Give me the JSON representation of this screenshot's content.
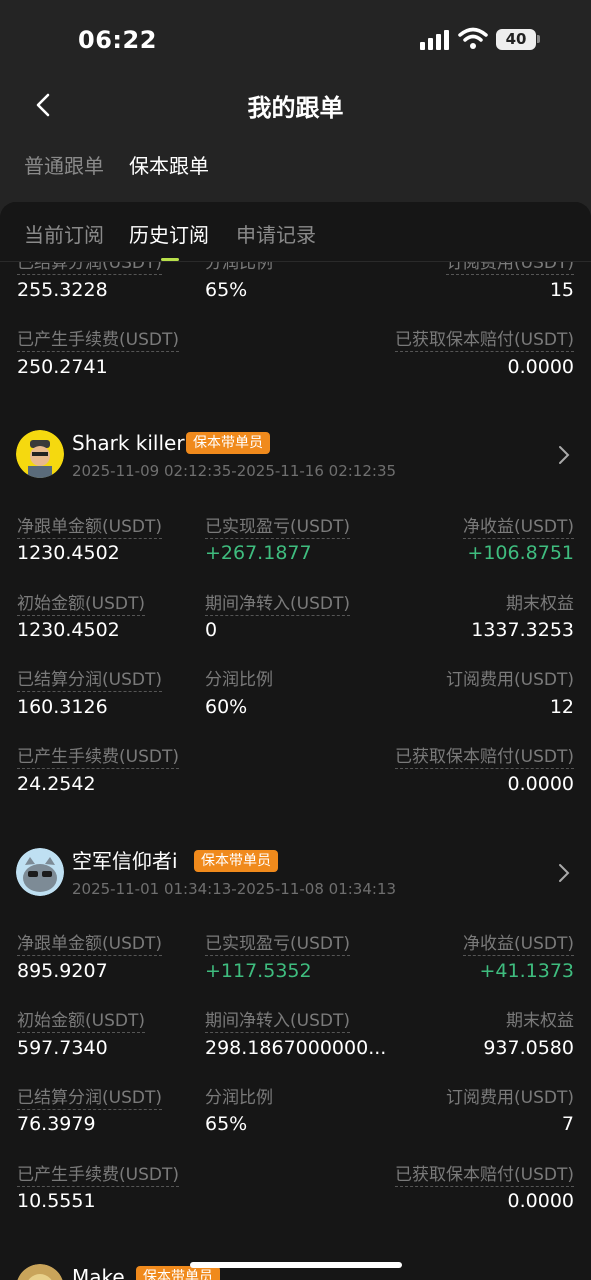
{
  "status": {
    "time": "06:22",
    "battery": "40"
  },
  "nav": {
    "title": "我的跟单"
  },
  "type_tabs": [
    "普通跟单",
    "保本跟单"
  ],
  "sub_tabs": [
    "当前订阅",
    "历史订阅",
    "申请记录"
  ],
  "top_partial": {
    "labels": [
      "已结算分润(USDT)",
      "分润比例",
      "订阅费用(USDT)",
      "已产生手续费(USDT)",
      "已获取保本赔付(USDT)"
    ],
    "settled_profit": "255.3228",
    "profit_ratio": "65%",
    "subscription_fee": "15",
    "fees": "250.2741",
    "compensation": "0.0000"
  },
  "labels": {
    "net_follow": "净跟单金额(USDT)",
    "realized_pnl": "已实现盈亏(USDT)",
    "net_income": "净收益(USDT)",
    "initial": "初始金额(USDT)",
    "net_transfer": "期间净转入(USDT)",
    "final_equity": "期末权益",
    "settled_profit": "已结算分润(USDT)",
    "profit_ratio": "分润比例",
    "subscription_fee": "订阅费用(USDT)",
    "fees": "已产生手续费(USDT)",
    "compensation": "已获取保本赔付(USDT)"
  },
  "traders": [
    {
      "name": "Shark killer",
      "badge": "保本带单员",
      "range": "2025-11-09 02:12:35-2025-11-16 02:12:35",
      "net_follow": "1230.4502",
      "realized_pnl": "+267.1877",
      "net_income": "+106.8751",
      "initial": "1230.4502",
      "net_transfer": "0",
      "final_equity": "1337.3253",
      "settled_profit": "160.3126",
      "profit_ratio": "60%",
      "subscription_fee": "12",
      "fees": "24.2542",
      "compensation": "0.0000"
    },
    {
      "name": "空军信仰者i",
      "badge": "保本带单员",
      "range": "2025-11-01 01:34:13-2025-11-08 01:34:13",
      "net_follow": "895.9207",
      "realized_pnl": "+117.5352",
      "net_income": "+41.1373",
      "initial": "597.7340",
      "net_transfer": "298.1867000000...",
      "final_equity": "937.0580",
      "settled_profit": "76.3979",
      "profit_ratio": "65%",
      "subscription_fee": "7",
      "fees": "10.5551",
      "compensation": "0.0000"
    },
    {
      "name": "Make",
      "badge": "保本带单员"
    }
  ],
  "colors": {
    "positive": "#3fbd7f",
    "badge": "#f08a1c",
    "accent": "#b8e04a"
  }
}
